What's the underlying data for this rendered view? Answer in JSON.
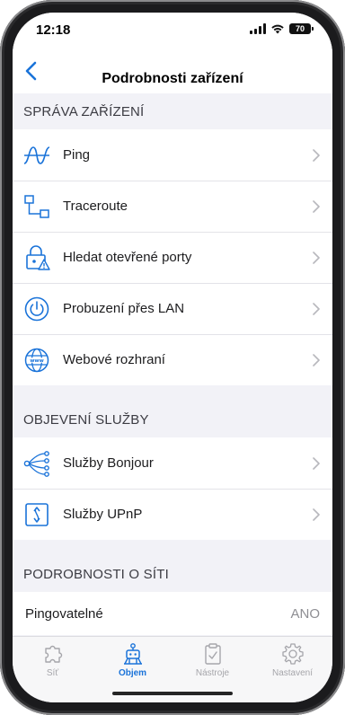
{
  "status_bar": {
    "time": "12:18",
    "battery": "70"
  },
  "nav": {
    "title": "Podrobnosti zařízení",
    "back_icon": "chevron-left-icon"
  },
  "sections": {
    "device_management": {
      "header": "SPRÁVA ZAŘÍZENÍ",
      "items": [
        {
          "label": "Ping",
          "icon": "ping-wave-icon"
        },
        {
          "label": "Traceroute",
          "icon": "traceroute-icon"
        },
        {
          "label": "Hledat otevřené porty",
          "icon": "port-lock-warning-icon"
        },
        {
          "label": "Probuzení přes LAN",
          "icon": "power-icon"
        },
        {
          "label": "Webové rozhraní",
          "icon": "www-globe-icon"
        }
      ]
    },
    "service_discovery": {
      "header": "OBJEVENÍ SLUŽBY",
      "items": [
        {
          "label": "Služby Bonjour",
          "icon": "bonjour-icon"
        },
        {
          "label": "Služby UPnP",
          "icon": "upnp-icon"
        }
      ]
    },
    "network_details": {
      "header": "PODROBNOSTI O SÍTI",
      "rows": [
        {
          "label": "Pingovatelné",
          "value": "ANO"
        }
      ]
    }
  },
  "tabbar": {
    "tabs": [
      {
        "label": "Síť",
        "icon": "network-puzzle-icon",
        "active": false
      },
      {
        "label": "Objem",
        "icon": "volume-robot-icon",
        "active": true
      },
      {
        "label": "Nástroje",
        "icon": "clipboard-icon",
        "active": false
      },
      {
        "label": "Nastavení",
        "icon": "gear-icon",
        "active": false
      }
    ]
  },
  "colors": {
    "accent": "#1a73d9",
    "inactive": "#a5a5aa",
    "background": "#f2f2f7"
  }
}
